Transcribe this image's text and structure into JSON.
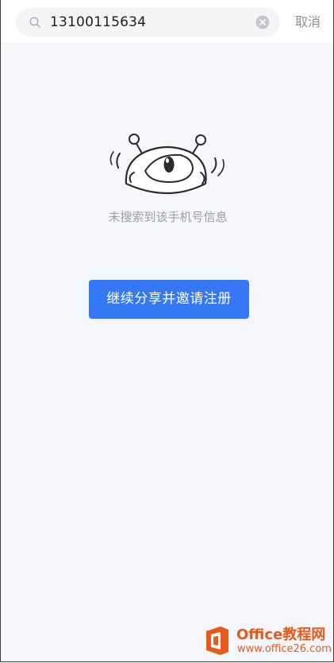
{
  "search": {
    "value": "13100115634",
    "cancel_label": "取消",
    "search_icon": "search-icon",
    "clear_icon": "clear-icon"
  },
  "empty_state": {
    "illustration": "alien-mascot-illustration",
    "message": "未搜索到该手机号信息"
  },
  "actions": {
    "share_invite_label": "继续分享并邀请注册"
  },
  "watermark": {
    "brand": "Office教程网",
    "url": "www.office26.com"
  },
  "colors": {
    "accent": "#3478f6",
    "background": "#f5f6fa",
    "muted_text": "#9a9ea6",
    "watermark": "#e8591c"
  }
}
